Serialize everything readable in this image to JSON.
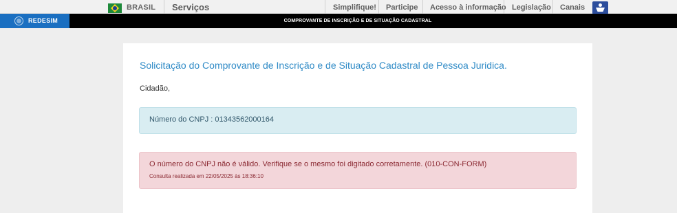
{
  "gov_bar": {
    "country": "BRASIL",
    "services": "Serviços",
    "links": [
      "Simplifique!",
      "Participe",
      "Acesso à informação",
      "Legislação",
      "Canais"
    ],
    "icons": {
      "flag": "brazil-flag-icon",
      "accessibility": "accessibility-icon"
    },
    "colors": {
      "flag_green": "#1f8a3b",
      "flag_yellow": "#f4d21f",
      "flag_blue": "#1c3f94",
      "accessibility_bg": "#2c4d9c"
    }
  },
  "header": {
    "logo_text": "REDESIM",
    "title": "COMPROVANTE DE INSCRIÇÃO E DE SITUAÇÃO CADASTRAL",
    "colors": {
      "logo_bg": "#1a6fc1",
      "bar_bg": "#000000"
    }
  },
  "main": {
    "title": "Solicitação do Comprovante de Inscrição e de Situação Cadastral de Pessoa Juridica.",
    "greeting": "Cidadão,",
    "info_message": "Número do CNPJ : 01343562000164",
    "error_message": "O número do CNPJ não é válido. Verifique se o mesmo foi digitado corretamente. (010-CON-FORM)",
    "consultation_time": "Consulta realizada em 22/05/2025 às 18:36:10",
    "colors": {
      "title": "#2e8ac6",
      "info_bg": "#d9edf2",
      "error_bg": "#f3d6da",
      "error_text": "#8b2a33"
    }
  }
}
